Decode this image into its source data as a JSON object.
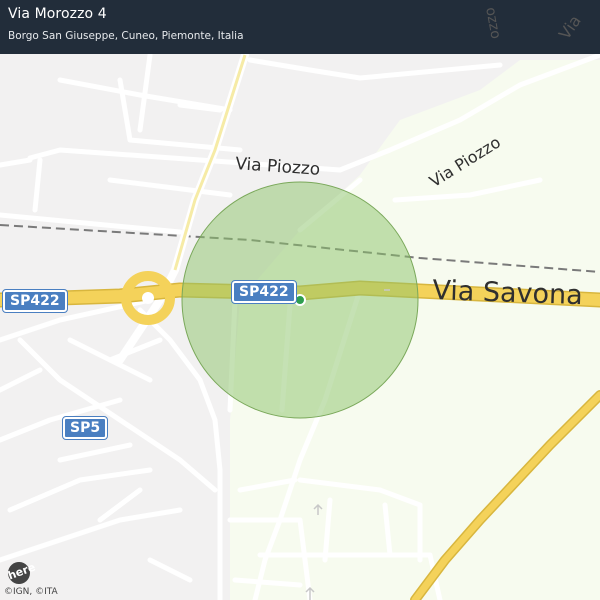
{
  "header": {
    "title": "Via Morozzo 4",
    "subtitle": "Borgo San Giuseppe, Cuneo, Piemonte, Italia"
  },
  "map": {
    "road_labels": {
      "sp422_left": "SP422",
      "sp422_center": "SP422",
      "sp5": "SP5"
    },
    "street_labels": {
      "via_piozzo_1": "Via  Piozzo",
      "via_piozzo_2": "Via Piozzo",
      "via_savona": "Via  Savona",
      "via_top_right_1": "ozzo",
      "via_top_right_2": "Via"
    },
    "attribution": "©IGN, ©ITA",
    "logo_text": "here",
    "colors": {
      "background": "#f2f1f1",
      "countryside": "#f7fbef",
      "main_road": "#f4d25a",
      "accuracy_circle": "#8cc46a",
      "marker": "#2e9e4f",
      "shield": "#4a7fc1",
      "header": "#222d3a"
    }
  }
}
